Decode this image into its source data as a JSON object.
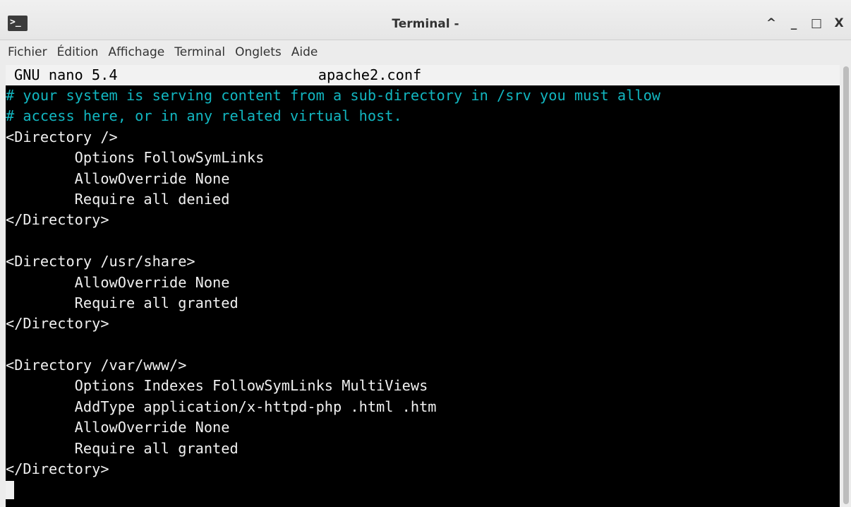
{
  "window": {
    "title": "Terminal -",
    "controls": {
      "minimize_up": "^",
      "minimize": "_",
      "maximize": "□",
      "close": "X"
    }
  },
  "menu": [
    "Fichier",
    "Édition",
    "Affichage",
    "Terminal",
    "Onglets",
    "Aide"
  ],
  "nano": {
    "version": "GNU nano 5.4",
    "filename": "apache2.conf"
  },
  "lines": [
    {
      "text": "# your system is serving content from a sub-directory in /srv you must allow",
      "type": "comment"
    },
    {
      "text": "# access here, or in any related virtual host.",
      "type": "comment"
    },
    {
      "text": "<Directory />",
      "type": "code"
    },
    {
      "text": "        Options FollowSymLinks",
      "type": "code"
    },
    {
      "text": "        AllowOverride None",
      "type": "code"
    },
    {
      "text": "        Require all denied",
      "type": "code"
    },
    {
      "text": "</Directory>",
      "type": "code"
    },
    {
      "text": "",
      "type": "code"
    },
    {
      "text": "<Directory /usr/share>",
      "type": "code"
    },
    {
      "text": "        AllowOverride None",
      "type": "code"
    },
    {
      "text": "        Require all granted",
      "type": "code"
    },
    {
      "text": "</Directory>",
      "type": "code"
    },
    {
      "text": "",
      "type": "code"
    },
    {
      "text": "<Directory /var/www/>",
      "type": "code"
    },
    {
      "text": "        Options Indexes FollowSymLinks MultiViews",
      "type": "code"
    },
    {
      "text": "        AddType application/x-httpd-php .html .htm",
      "type": "code"
    },
    {
      "text": "        AllowOverride None",
      "type": "code"
    },
    {
      "text": "        Require all granted",
      "type": "code"
    },
    {
      "text": "</Directory>",
      "type": "code"
    }
  ],
  "colors": {
    "comment": "#12b6c0",
    "terminal_bg": "#000000",
    "terminal_fg": "#f0f0f0"
  }
}
